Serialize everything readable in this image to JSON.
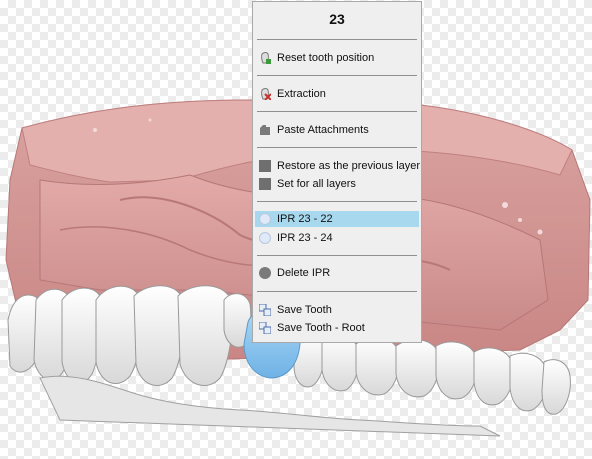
{
  "context_menu": {
    "title": "23",
    "items": [
      {
        "label": "Reset tooth position",
        "icon": "reset-tooth-icon"
      },
      {
        "label": "Extraction",
        "icon": "extraction-icon"
      },
      {
        "label": "Paste Attachments",
        "icon": "paste-attachments-icon"
      },
      {
        "label": "Restore as the previous layer",
        "icon": "restore-layer-icon"
      },
      {
        "label": "Set for all layers",
        "icon": "set-all-layers-icon"
      },
      {
        "label": "IPR 23 - 22",
        "icon": "ipr-icon",
        "selected": true
      },
      {
        "label": "IPR 23 - 24",
        "icon": "ipr-icon"
      },
      {
        "label": "Delete IPR",
        "icon": "delete-ipr-icon"
      },
      {
        "label": "Save Tooth",
        "icon": "save-tooth-icon"
      },
      {
        "label": "Save Tooth - Root",
        "icon": "save-tooth-root-icon"
      }
    ]
  },
  "colors": {
    "gum": "#d99a9a",
    "tooth": "#ffffff",
    "selected_tooth": "#8cc7ee",
    "menu_highlight": "#a8d8ee"
  }
}
